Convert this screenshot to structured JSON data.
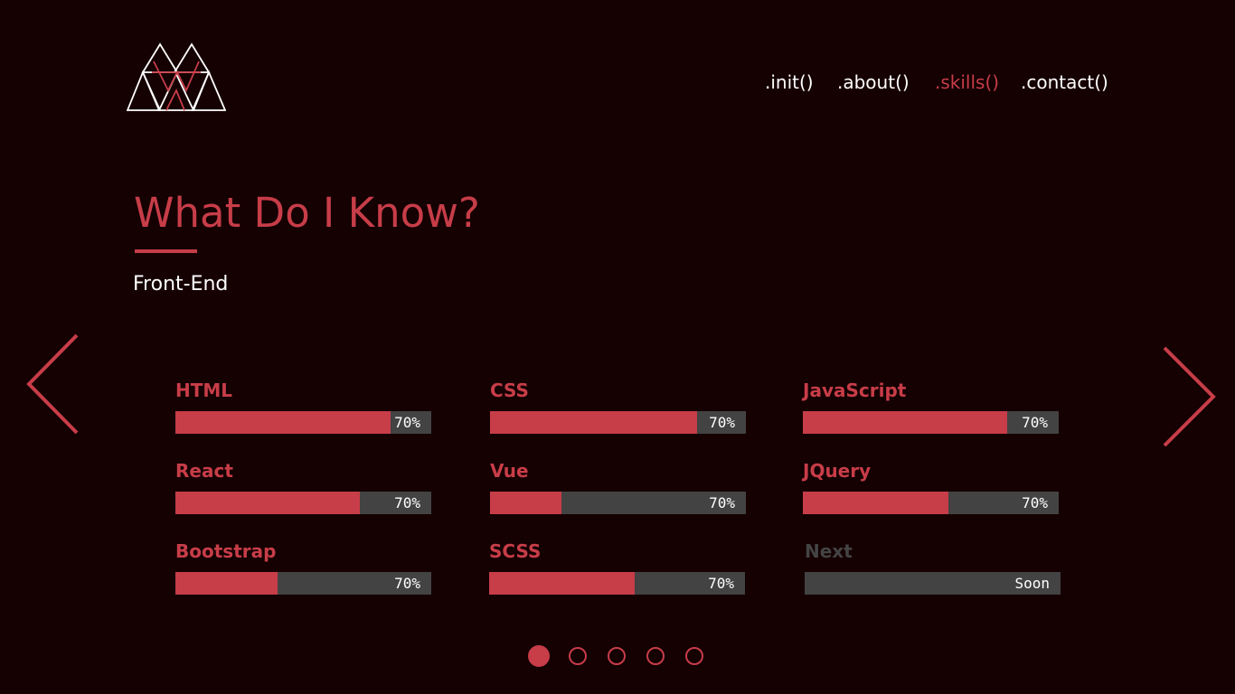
{
  "nav": {
    "items": [
      {
        "label": ".init()"
      },
      {
        "label": ".about()"
      },
      {
        "label": ".skills()"
      },
      {
        "label": ".contact()"
      }
    ],
    "active_index": 2
  },
  "header": {
    "title": "What Do I Know?",
    "subtitle": "Front-End"
  },
  "skills": [
    {
      "name": "HTML",
      "level": 0.84,
      "label": "70%"
    },
    {
      "name": "CSS",
      "level": 0.81,
      "label": "70%"
    },
    {
      "name": "JavaScript",
      "level": 0.8,
      "label": "70%"
    },
    {
      "name": "React",
      "level": 0.72,
      "label": "70%"
    },
    {
      "name": "Vue",
      "level": 0.28,
      "label": "70%"
    },
    {
      "name": "JQuery",
      "level": 0.57,
      "label": "70%"
    },
    {
      "name": "Bootstrap",
      "level": 0.4,
      "label": "70%"
    },
    {
      "name": "SCSS",
      "level": 0.57,
      "label": "70%"
    },
    {
      "name": "Next",
      "level": 0,
      "label": "Soon"
    }
  ],
  "pagination": {
    "count": 5,
    "active_index": 0
  },
  "colors": {
    "background": "#150002",
    "accent": "#c73d48",
    "bar_track": "#434343",
    "text": "#ffffff",
    "muted": "#444444"
  },
  "icons": {
    "logo": "triangle-mountains-logo",
    "prev": "chevron-left-icon",
    "next": "chevron-right-icon"
  }
}
